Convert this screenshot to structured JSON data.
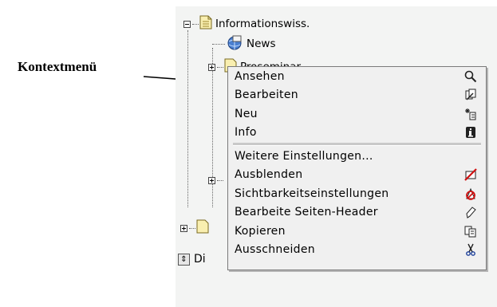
{
  "annotation": {
    "label": "Kontextmenü"
  },
  "tree": {
    "root_label": "Informationswiss.",
    "child_news": "News",
    "child_partial": "Proseminar",
    "bottom_label": "Di"
  },
  "context_menu": {
    "items": [
      {
        "label": "Ansehen",
        "icon": "magnifier-icon"
      },
      {
        "label": "Bearbeiten",
        "icon": "edit-pages-icon"
      },
      {
        "label": "Neu",
        "icon": "new-sparkle-icon"
      },
      {
        "label": "Info",
        "icon": "info-icon"
      },
      {
        "label": "Weitere Einstellungen...",
        "icon": ""
      },
      {
        "label": "Ausblenden",
        "icon": "hide-icon"
      },
      {
        "label": "Sichtbarkeitseinstellungen",
        "icon": "visibility-icon"
      },
      {
        "label": "Bearbeite Seiten-Header",
        "icon": "pen-icon"
      },
      {
        "label": "Kopieren",
        "icon": "copy-icon"
      },
      {
        "label": "Ausschneiden",
        "icon": "scissors-icon"
      }
    ]
  }
}
